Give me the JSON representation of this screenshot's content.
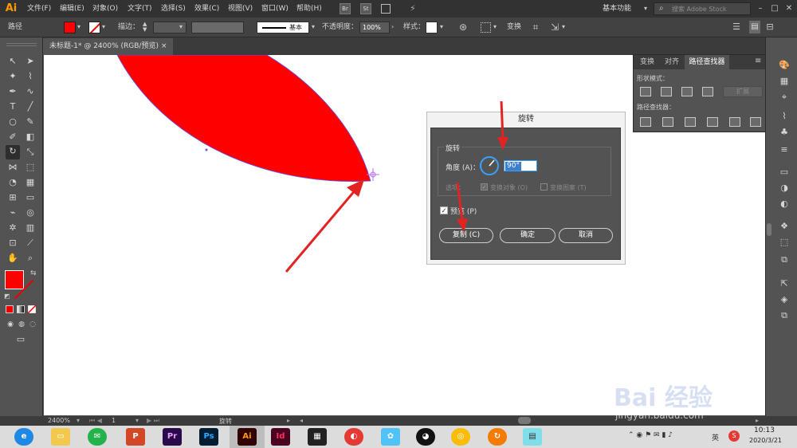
{
  "app": {
    "logo": "Ai"
  },
  "menu": [
    "文件(F)",
    "编辑(E)",
    "对象(O)",
    "文字(T)",
    "选择(S)",
    "效果(C)",
    "视图(V)",
    "窗口(W)",
    "帮助(H)"
  ],
  "menu_badges": [
    "Br",
    "St"
  ],
  "workspace": "基本功能",
  "search": {
    "placeholder": "搜索 Adobe Stock"
  },
  "control_bar": {
    "object_type": "路径",
    "stroke_label": "描边：",
    "style_line": "基本",
    "opacity_label": "不透明度：",
    "opacity_value": "100%",
    "style_label": "样式：",
    "transform_label": "变换"
  },
  "document_tab": {
    "title": "未标题-1* @ 2400% (RGB/预览)",
    "close": "×"
  },
  "panel": {
    "tabs": [
      "变换",
      "对齐",
      "路径查找器"
    ],
    "shape_modes_label": "形状模式：",
    "expand_label": "扩展",
    "pathfinders_label": "路径查找器："
  },
  "dialog": {
    "title": "旋转",
    "group_label": "旋转",
    "angle_label": "角度 (A)：",
    "angle_value": "90°",
    "options_label": "选项：",
    "transform_objects": "变换对象 (O)",
    "transform_patterns": "变换图案 (T)",
    "preview_label": "预览 (P)",
    "copy_button": "复制 (C)",
    "ok_button": "确定",
    "cancel_button": "取消"
  },
  "status_bar": {
    "zoom": "2400%",
    "artboard": "1",
    "tool_name": "旋转"
  },
  "taskbar": {
    "time": "10:13",
    "date": "2020/3/21",
    "ime": "英",
    "apps": [
      "Pr",
      "Ps",
      "Ai",
      "Id"
    ]
  },
  "watermark": {
    "brand": "Bai 经验",
    "url": "jingyan.baidu.com"
  },
  "colors": {
    "fill": "#ff0000",
    "accent_orange": "#ff9a00",
    "arrow": "#e32222",
    "selection": "#7a7aff"
  }
}
